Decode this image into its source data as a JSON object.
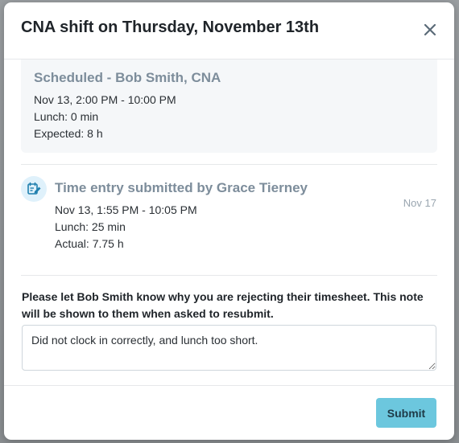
{
  "modal": {
    "title": "CNA shift on Thursday, November 13th"
  },
  "scheduled": {
    "title": "Scheduled - Bob Smith, CNA",
    "time": "Nov 13, 2:00 PM - 10:00 PM",
    "lunch": "Lunch: 0 min",
    "expected": "Expected: 8 h"
  },
  "entry": {
    "icon": "edit-document-icon",
    "title": "Time entry submitted by Grace Tierney",
    "date": "Nov 17",
    "time": "Nov 13, 1:55 PM - 10:05 PM",
    "lunch": "Lunch: 25 min",
    "actual": "Actual: 7.75 h"
  },
  "rejection": {
    "prompt": "Please let Bob Smith know why you are rejecting their timesheet. This note will be shown to them when asked to resubmit.",
    "note_value": "Did not clock in correctly, and lunch too short."
  },
  "footer": {
    "submit_label": "Submit"
  },
  "colors": {
    "accent": "#6cc7de",
    "muted_title": "#7d8d9b",
    "card_bg": "#f5f7f9"
  }
}
